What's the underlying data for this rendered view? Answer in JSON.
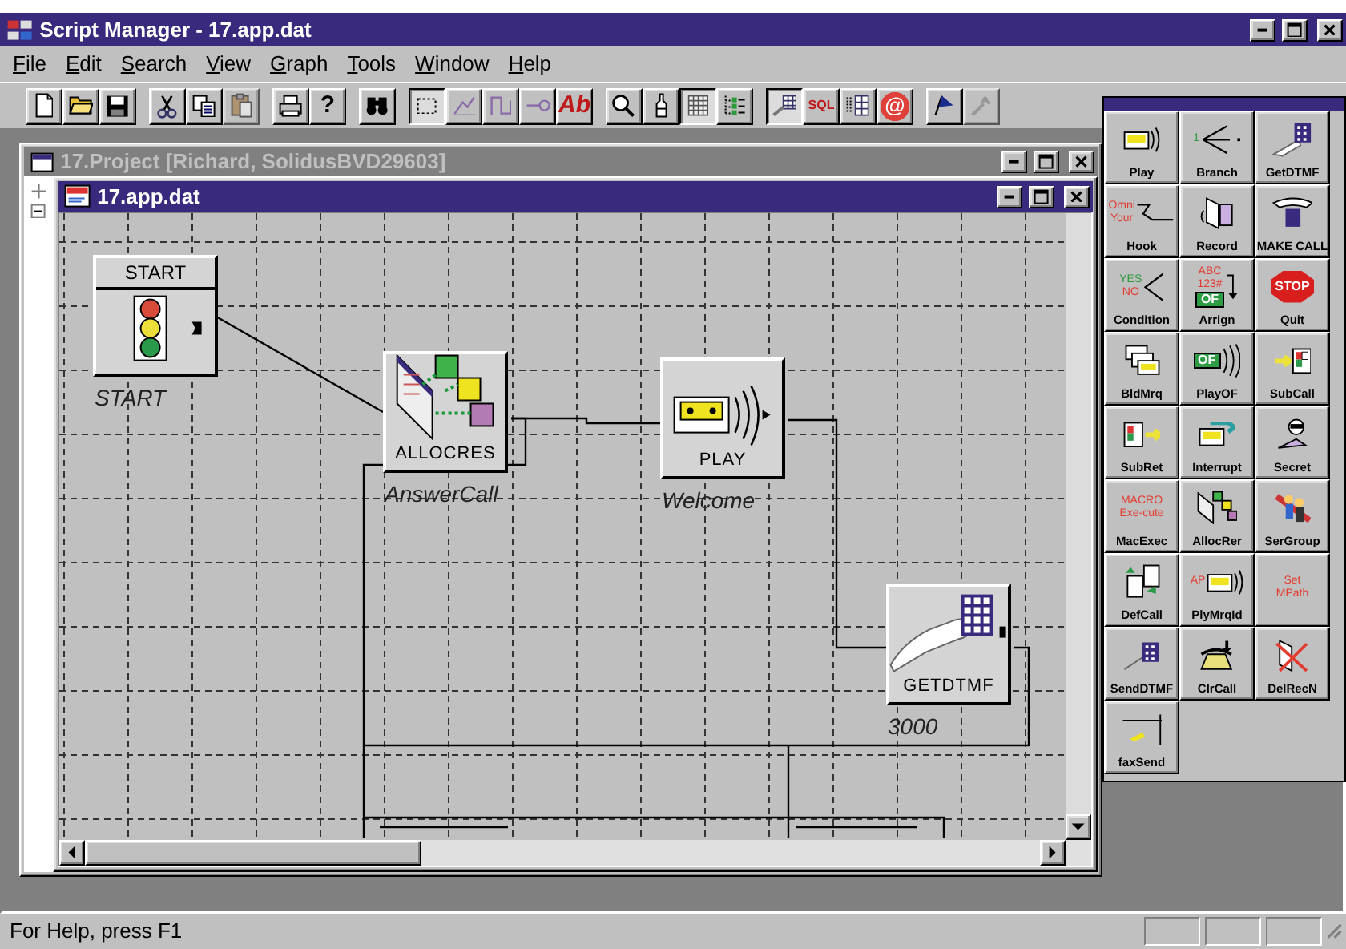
{
  "window": {
    "title": "Script Manager - 17.app.dat",
    "active": true
  },
  "menu": [
    "File",
    "Edit",
    "Search",
    "View",
    "Graph",
    "Tools",
    "Window",
    "Help"
  ],
  "toolbar": [
    {
      "buttons": [
        {
          "kind": "new",
          "pressed": false,
          "disabled": false
        },
        {
          "kind": "open",
          "pressed": false,
          "disabled": false
        },
        {
          "kind": "save",
          "pressed": false,
          "disabled": false
        }
      ]
    },
    {
      "buttons": [
        {
          "kind": "cut",
          "pressed": false,
          "disabled": false
        },
        {
          "kind": "copy",
          "pressed": false,
          "disabled": false
        },
        {
          "kind": "paste",
          "pressed": false,
          "disabled": true
        }
      ]
    },
    {
      "buttons": [
        {
          "kind": "print",
          "pressed": false,
          "disabled": false
        },
        {
          "kind": "help",
          "text": "?",
          "pressed": false,
          "disabled": false
        }
      ]
    },
    {
      "buttons": [
        {
          "kind": "find",
          "pressed": false,
          "disabled": false
        }
      ]
    },
    {
      "buttons": [
        {
          "kind": "select",
          "pressed": true,
          "disabled": false
        },
        {
          "kind": "line",
          "pressed": false,
          "disabled": false
        },
        {
          "kind": "elbow",
          "pressed": false,
          "disabled": false
        },
        {
          "kind": "connector",
          "pressed": false,
          "disabled": false
        },
        {
          "kind": "text",
          "text": "Ab",
          "pressed": false,
          "disabled": false
        }
      ]
    },
    {
      "buttons": [
        {
          "kind": "zoom",
          "pressed": false,
          "disabled": false
        },
        {
          "kind": "bottle",
          "pressed": false,
          "disabled": false
        },
        {
          "kind": "grid",
          "pressed": true,
          "disabled": false
        },
        {
          "kind": "tree",
          "pressed": false,
          "disabled": false
        }
      ]
    },
    {
      "buttons": [
        {
          "kind": "script",
          "pressed": true,
          "disabled": false
        },
        {
          "kind": "sql",
          "text": "SQL",
          "pressed": false,
          "disabled": false
        },
        {
          "kind": "table",
          "pressed": false,
          "disabled": false
        },
        {
          "kind": "at",
          "text": "@",
          "pressed": false,
          "disabled": false
        }
      ]
    },
    {
      "buttons": [
        {
          "kind": "flag",
          "pressed": false,
          "disabled": false
        },
        {
          "kind": "tool",
          "pressed": false,
          "disabled": true
        }
      ]
    }
  ],
  "project_window": {
    "title": "17.Project [Richard, SolidusBVD29603]",
    "active": false
  },
  "document_window": {
    "title": "17.app.dat",
    "active": true
  },
  "diagram": {
    "nodes": [
      {
        "kind": "start",
        "caption": "START",
        "label": "START"
      },
      {
        "kind": "allocres",
        "caption": "ALLOCRES",
        "label": "AnswerCall"
      },
      {
        "kind": "play",
        "caption": "PLAY",
        "label": "Welcome"
      },
      {
        "kind": "getdtmf",
        "caption": "GETDTMF",
        "label": "3000"
      }
    ]
  },
  "palette": {
    "tiles": [
      {
        "kind": "play",
        "label": "Play"
      },
      {
        "kind": "branch",
        "label": "Branch",
        "icon_text": [
          "1"
        ]
      },
      {
        "kind": "getdtmf",
        "label": "GetDTMF"
      },
      {
        "kind": "hook",
        "label": "Hook",
        "icon_text": [
          "Omni",
          "Your"
        ]
      },
      {
        "kind": "record",
        "label": "Record"
      },
      {
        "kind": "makecall",
        "label": "MAKE CALL"
      },
      {
        "kind": "condition",
        "label": "Condition",
        "icon_text": [
          "YES",
          "NO"
        ]
      },
      {
        "kind": "assign",
        "label": "Arrign",
        "icon_text": [
          "ABC",
          "123#",
          "OF"
        ]
      },
      {
        "kind": "quit",
        "label": "Quit",
        "icon_text": [
          "STOP"
        ]
      },
      {
        "kind": "bldmrq",
        "label": "BldMrq"
      },
      {
        "kind": "playof",
        "label": "PlayOF",
        "icon_text": [
          "OF"
        ]
      },
      {
        "kind": "subcall",
        "label": "SubCall"
      },
      {
        "kind": "subret",
        "label": "SubRet"
      },
      {
        "kind": "interrupt",
        "label": "Interrupt"
      },
      {
        "kind": "secret",
        "label": "Secret"
      },
      {
        "kind": "macexec",
        "label": "MacExec",
        "icon_text": [
          "MACRO",
          "Exe-cute"
        ]
      },
      {
        "kind": "allocres",
        "label": "AllocRer"
      },
      {
        "kind": "sergroup",
        "label": "SerGroup"
      },
      {
        "kind": "defcall",
        "label": "DefCall"
      },
      {
        "kind": "plymrqid",
        "label": "PlyMrqId",
        "icon_text": [
          "AP"
        ]
      },
      {
        "kind": "setmpath",
        "icon_text": [
          "Set",
          "MPath"
        ]
      },
      {
        "kind": "senddtmf",
        "label": "SendDTMF"
      },
      {
        "kind": "clrcall",
        "label": "ClrCall"
      },
      {
        "kind": "delrecn",
        "label": "DelRecN"
      },
      {
        "kind": "faxsend",
        "label": "faxSend"
      }
    ]
  },
  "status_bar": {
    "text": "For Help, press F1"
  }
}
